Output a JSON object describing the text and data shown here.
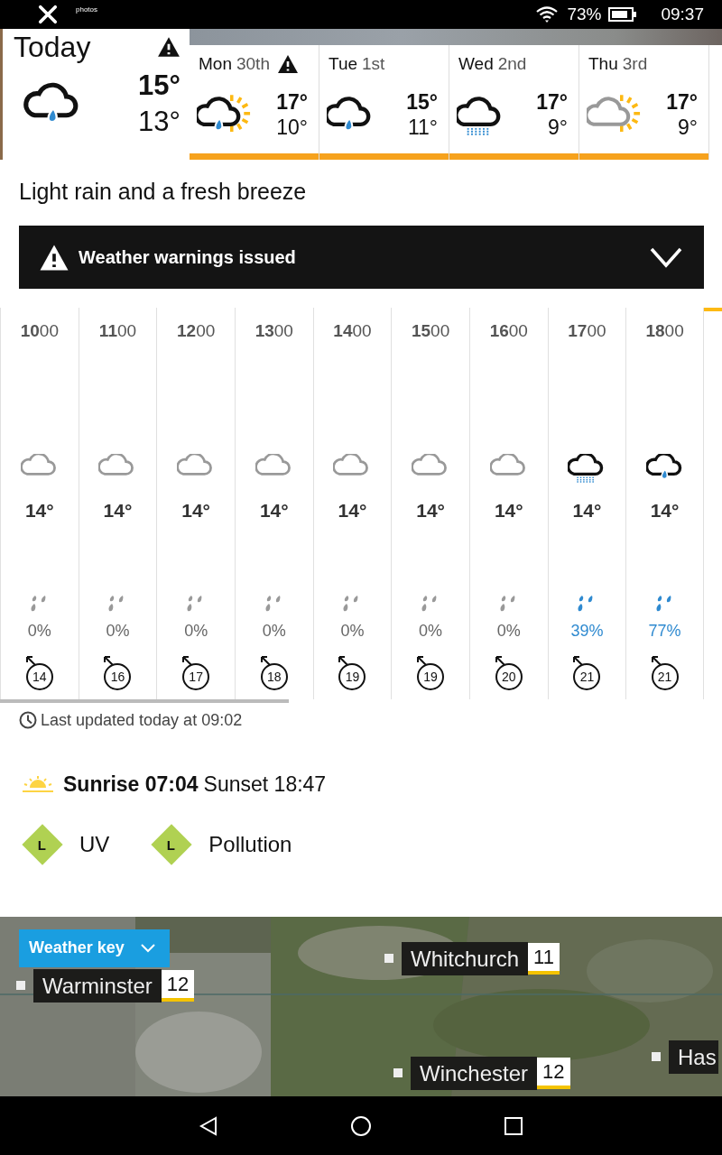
{
  "status_bar": {
    "notification_label": "photos",
    "battery": "73%",
    "time": "09:37"
  },
  "today": {
    "title": "Today",
    "warning": true,
    "kind": "rain-cloud",
    "high": "15°",
    "low": "13°"
  },
  "days": [
    {
      "day": "Mon",
      "date": "30th",
      "warning": true,
      "kind": "sun-rain",
      "high": "17°",
      "low": "10°"
    },
    {
      "day": "Tue",
      "date": "1st",
      "warning": false,
      "kind": "rain-cloud",
      "high": "15°",
      "low": "11°"
    },
    {
      "day": "Wed",
      "date": "2nd",
      "warning": false,
      "kind": "drizzle",
      "high": "17°",
      "low": "9°"
    },
    {
      "day": "Thu",
      "date": "3rd",
      "warning": false,
      "kind": "sun-cloud",
      "high": "17°",
      "low": "9°"
    }
  ],
  "summary": "Light rain and a fresh breeze",
  "warning_banner": {
    "text": "Weather warnings issued",
    "expanded": false
  },
  "hours": [
    {
      "time": "**10**00",
      "kind": "cloud",
      "temp": "14°",
      "rain_chance": "0%",
      "rain_likely": false,
      "wind": "14"
    },
    {
      "time": "**11**00",
      "kind": "cloud",
      "temp": "14°",
      "rain_chance": "0%",
      "rain_likely": false,
      "wind": "16"
    },
    {
      "time": "**12**00",
      "kind": "cloud",
      "temp": "14°",
      "rain_chance": "0%",
      "rain_likely": false,
      "wind": "17"
    },
    {
      "time": "**13**00",
      "kind": "cloud",
      "temp": "14°",
      "rain_chance": "0%",
      "rain_likely": false,
      "wind": "18"
    },
    {
      "time": "**14**00",
      "kind": "cloud",
      "temp": "14°",
      "rain_chance": "0%",
      "rain_likely": false,
      "wind": "19"
    },
    {
      "time": "**15**00",
      "kind": "cloud",
      "temp": "14°",
      "rain_chance": "0%",
      "rain_likely": false,
      "wind": "19"
    },
    {
      "time": "**16**00",
      "kind": "cloud",
      "temp": "14°",
      "rain_chance": "0%",
      "rain_likely": false,
      "wind": "20"
    },
    {
      "time": "**17**00",
      "kind": "drizzle",
      "temp": "14°",
      "rain_chance": "39%",
      "rain_likely": true,
      "wind": "21"
    },
    {
      "time": "**18**00",
      "kind": "rain-cloud",
      "temp": "14°",
      "rain_chance": "77%",
      "rain_likely": true,
      "wind": "21"
    }
  ],
  "last_updated": "Last updated today at 09:02",
  "sun": {
    "sunrise": "Sunrise 07:04",
    "sunset": "Sunset 18:47"
  },
  "indices": [
    {
      "name": "UV",
      "band": "L",
      "color": "#b0d152"
    },
    {
      "name": "Pollution",
      "band": "L",
      "color": "#b0d152"
    }
  ],
  "map": {
    "key_button": "Weather key",
    "places": [
      {
        "name": "Warminster",
        "temp": "12"
      },
      {
        "name": "Whitchurch",
        "temp": "11"
      },
      {
        "name": "Winchester",
        "temp": "12"
      },
      {
        "name": "Has"
      }
    ]
  }
}
